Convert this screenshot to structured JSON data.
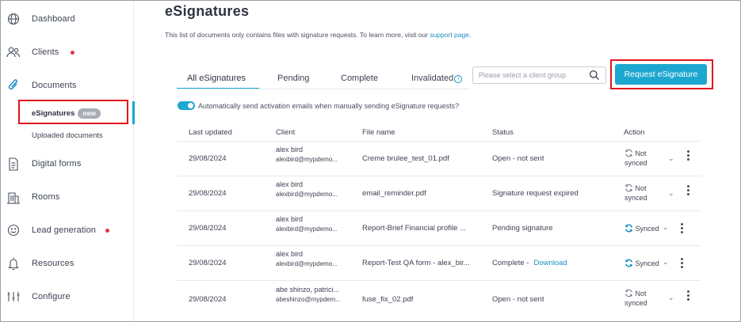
{
  "sidebar": {
    "items": [
      {
        "label": "Dashboard",
        "icon": "globe-icon"
      },
      {
        "label": "Clients",
        "icon": "users-icon",
        "alert": true
      },
      {
        "label": "Documents",
        "icon": "paperclip-icon"
      },
      {
        "label": "Digital forms",
        "icon": "document-icon"
      },
      {
        "label": "Rooms",
        "icon": "building-icon"
      },
      {
        "label": "Lead generation",
        "icon": "smiley-icon",
        "alert": true
      },
      {
        "label": "Resources",
        "icon": "bell-icon"
      },
      {
        "label": "Configure",
        "icon": "sliders-icon"
      }
    ],
    "sub_items": [
      {
        "label": "eSignatures",
        "badge": "new",
        "active": true
      },
      {
        "label": "Uploaded documents"
      }
    ]
  },
  "page": {
    "title": "eSignatures",
    "subtitle_text": "This list of documents only contains files with signature requests. To learn more, visit our ",
    "subtitle_link": "support page",
    "subtitle_end": "."
  },
  "tabs": [
    {
      "label": "All eSignatures",
      "active": true
    },
    {
      "label": "Pending"
    },
    {
      "label": "Complete"
    },
    {
      "label": "Invalidated",
      "info": "i"
    }
  ],
  "search": {
    "placeholder": "Please select a client group"
  },
  "request_button": "Request eSignature",
  "toggle": {
    "on": true,
    "label": "Automatically send activation emails when manually sending eSignature requests?"
  },
  "table": {
    "headers": [
      "Last updated",
      "Client",
      "File name",
      "Status",
      "Action"
    ],
    "rows": [
      {
        "date": "29/08/2024",
        "client_name": "alex bird",
        "client_email": "alexbird@mypdemo...",
        "file": "Creme brulee_test_01.pdf",
        "status": "Open - not sent",
        "status_link": "",
        "action_line1": "Not",
        "action_line2": "synced",
        "synced": false
      },
      {
        "date": "29/08/2024",
        "client_name": "alex bird",
        "client_email": "alexbird@mypdemo...",
        "file": "email_reminder.pdf",
        "status": "Signature request expired",
        "status_link": "",
        "action_line1": "Not",
        "action_line2": "synced",
        "synced": false
      },
      {
        "date": "29/08/2024",
        "client_name": "alex bird",
        "client_email": "alexbird@mypdemo...",
        "file": "Report-Brief Financial profile ...",
        "status": "Pending signature",
        "status_link": "",
        "action_line1": "Synced",
        "action_line2": "",
        "synced": true
      },
      {
        "date": "29/08/2024",
        "client_name": "alex bird",
        "client_email": "alexbird@mypdemo...",
        "file": "Report-Test QA form - alex_bir...",
        "status": "Complete -",
        "status_link": "Download",
        "action_line1": "Synced",
        "action_line2": "",
        "synced": true
      },
      {
        "date": "29/08/2024",
        "client_name": "abe shinzo, patrici...",
        "client_email": "abeshinzo@mypdem...",
        "file": "fuse_fix_02.pdf",
        "status": "Open - not sent",
        "status_link": "",
        "action_line1": "Not",
        "action_line2": "synced",
        "synced": false
      }
    ]
  },
  "colors": {
    "accent": "#1da7d0",
    "highlight": "#e0161d",
    "alert_dot": "#e0334f"
  }
}
